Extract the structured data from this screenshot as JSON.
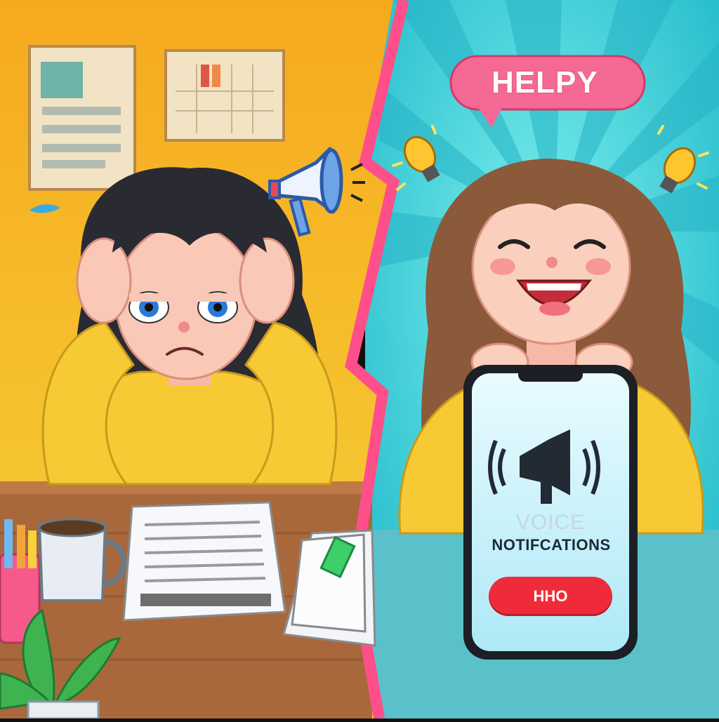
{
  "left_panel": {
    "wall_color": "#f3b81f",
    "mood": "stressed"
  },
  "right_panel": {
    "background_color": "#2ec8d6",
    "mood": "happy",
    "speech_bubble": {
      "text": "HELPY",
      "icon": "megaphone-icon"
    },
    "phone": {
      "title_line1": "VOICE",
      "title_line2": "NOTIFCATIONS",
      "button_label": "HHO",
      "icon": "megaphone-sound-icon"
    }
  },
  "colors": {
    "divider": "#ff4f8b",
    "sweater": "#f7c934",
    "button_red": "#ef2b3a"
  }
}
